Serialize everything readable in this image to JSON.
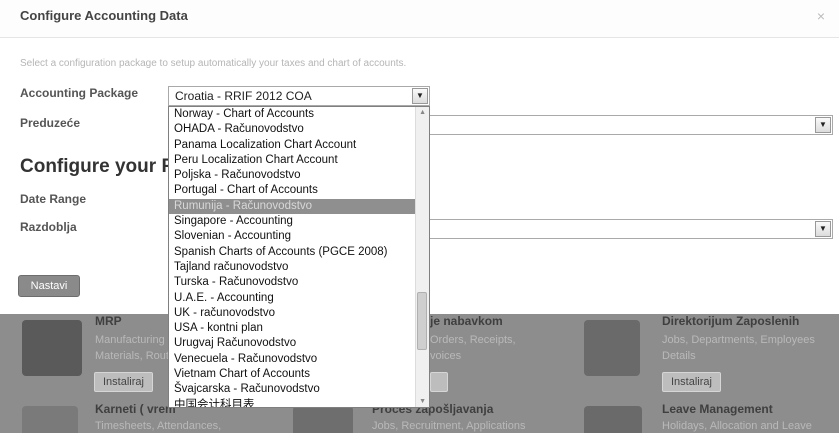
{
  "dialog": {
    "title": "Configure Accounting Data",
    "close": "×",
    "hint": "Select a configuration package to setup automatically your taxes and chart of accounts.",
    "accounting_package_label": "Accounting Package",
    "accounting_package_value": "Croatia - RRIF 2012 COA",
    "company_label": "Preduzeće",
    "section_title": "Configure your F",
    "date_range_label": "Date Range",
    "period_label": "Razdoblja",
    "next_button": "Nastavi"
  },
  "dropdown": {
    "items": [
      "Norway - Chart of Accounts",
      "OHADA - Računovodstvo",
      "Panama Localization Chart Account",
      "Peru Localization Chart Account",
      "Poljska - Računovodstvo",
      "Portugal - Chart of Accounts",
      "Rumunija - Računovodstvo",
      "Singapore - Accounting",
      "Slovenian - Accounting",
      "Spanish Charts of Accounts (PGCE 2008)",
      "Tajland računovodstvo",
      "Turska - Računovodstvo",
      "U.A.E. - Accounting",
      "UK - računovodstvo",
      "USA - kontni plan",
      "Urugvaj Računovodstvo",
      "Venecuela - Računovodstvo",
      "Vietnam Chart of Accounts",
      "Švajcarska - Računovodstvo",
      "中国会计科目表"
    ],
    "selected": "Rumunija - Računovodstvo"
  },
  "background_apps": {
    "mrp": {
      "title": "MRP",
      "desc1": "Manufacturing",
      "desc2": "Materials, Rout"
    },
    "purchase": {
      "title": "je nabavkom",
      "desc1": "Orders, Receipts,",
      "desc2": "voices"
    },
    "employees": {
      "title": "Direktorijum Zaposlenih",
      "desc1": "Jobs, Departments, Employees",
      "desc2": "Details"
    },
    "timesheets": {
      "title": "Karneti ( vrem",
      "desc1": "Timesheets, Attendances,"
    },
    "recruitment": {
      "title": "Proces zapošljavanja",
      "desc1": "Jobs, Recruitment, Applications"
    },
    "leave": {
      "title": "Leave Management",
      "desc1": "Holidays, Allocation and Leave"
    },
    "install_label": "Instaliraj"
  }
}
